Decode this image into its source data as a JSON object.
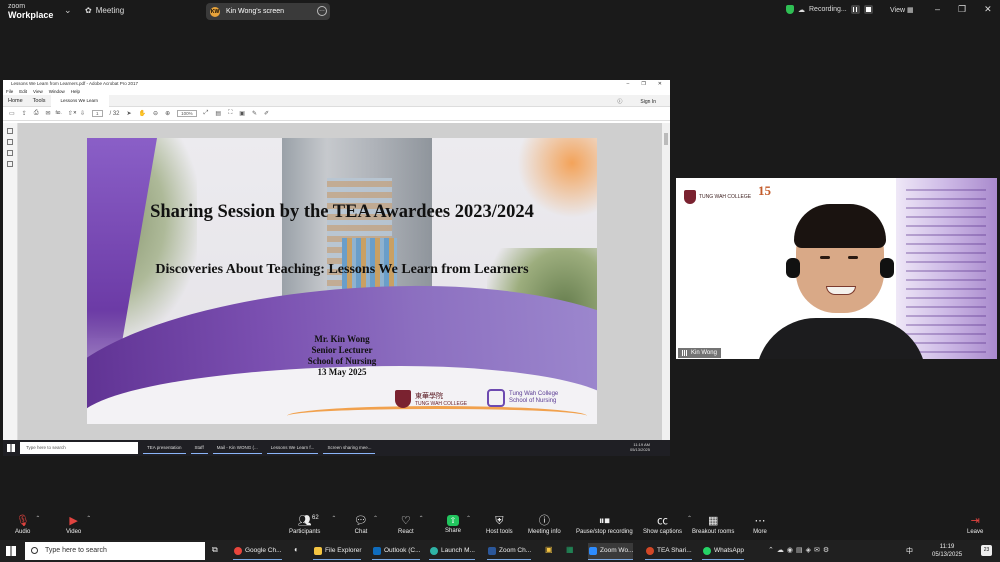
{
  "zoom_top": {
    "logo_line1": "zoom",
    "logo_line2": "Workplace",
    "meeting_label": "Meeting",
    "share_initials": "KW",
    "share_label": "Kin Wong's screen",
    "recording_label": "Recording...",
    "view_label": "View"
  },
  "acrobat": {
    "title": "Lessons We Learn from Learners.pdf - Adobe Acrobat Pro 2017",
    "menu": [
      "File",
      "Edit",
      "View",
      "Window",
      "Help"
    ],
    "tab_home": "Home",
    "tab_tools": "Tools",
    "doc_tab": "Lessons We Learn fr...",
    "sign_in": "Sign In",
    "page_current": "1",
    "page_total": "/ 32",
    "zoom": "100%"
  },
  "slide": {
    "title": "Sharing Session by the TEA Awardees 2023/2024",
    "subtitle": "Discoveries About Teaching: Lessons We Learn from Learners",
    "presenter_name": "Mr. Kin Wong",
    "presenter_role": "Senior Lecturer",
    "presenter_school": "School of Nursing",
    "date": "13 May 2025",
    "logo_twc_zh": "東華學院",
    "logo_twc_en": "TUNG WAH COLLEGE",
    "logo_nurs_1": "Tung Wah College",
    "logo_nurs_2": "School of Nursing"
  },
  "remote_taskbar": {
    "search": "Type here to search",
    "apps": [
      "TEA presentation",
      "Staff",
      "Mail - Kin WONG (...",
      "Lessons We Learn f...",
      "Screen sharing mee..."
    ],
    "time": "11:19 AM",
    "date": "05/13/2025"
  },
  "video_tile": {
    "name": "Kin Wong",
    "logo_en": "TUNG WAH COLLEGE",
    "logo2_num": "15"
  },
  "controls": {
    "audio": "Audio",
    "video": "Video",
    "participants": "Participants",
    "participant_count": "62",
    "chat": "Chat",
    "react": "React",
    "share": "Share",
    "host_tools": "Host tools",
    "meeting_info": "Meeting info",
    "pause_stop": "Pause/stop recording",
    "captions": "Show captions",
    "breakout": "Breakout rooms",
    "more": "More",
    "leave": "Leave"
  },
  "taskbar": {
    "search": "Type here to search",
    "apps": [
      "Google Ch...",
      "File Explorer",
      "Outlook (C...",
      "Launch M...",
      "Zoom Ch...",
      "Zoom Wo...",
      "TEA Shari...",
      "WhatsApp"
    ],
    "time": "11:19",
    "date": "05/13/2025",
    "notif": "23",
    "lang": "中"
  },
  "colors": {
    "zoom_bg": "#1a1a1a",
    "record_green": "#2fbf54",
    "share_green": "#22c55e",
    "leave_red": "#e0433f",
    "slide_purple": "#5b2d8e"
  }
}
